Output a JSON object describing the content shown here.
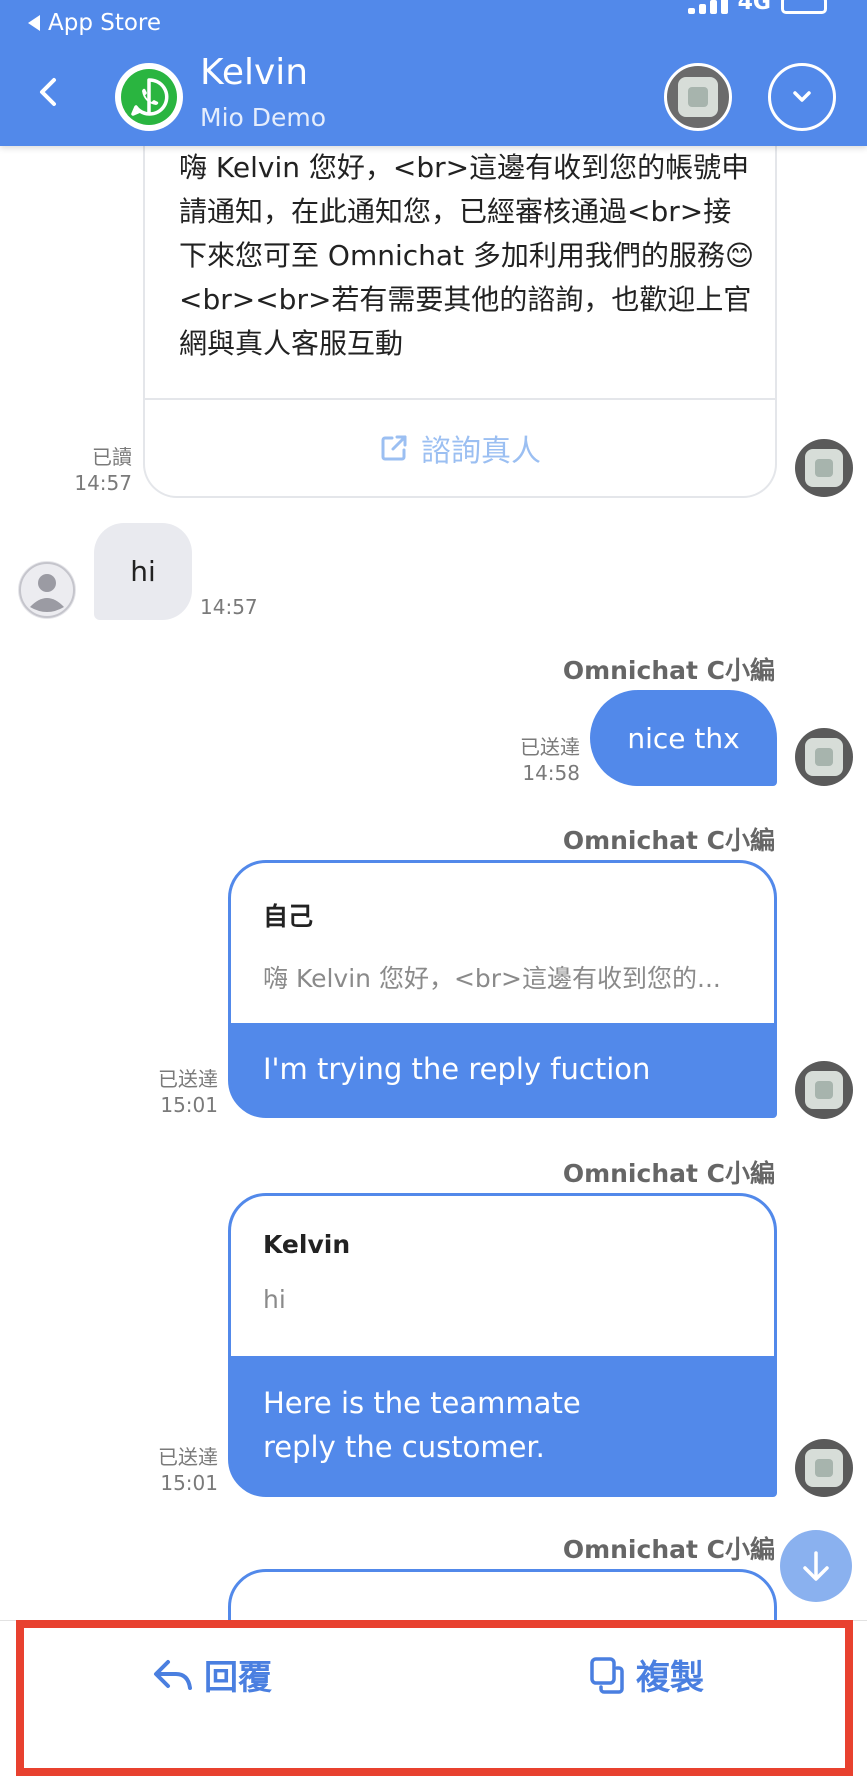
{
  "status_bar": {
    "back_app": "App Store",
    "network": "4G"
  },
  "header": {
    "title": "Kelvin",
    "subtitle": "Mio Demo"
  },
  "messages": {
    "bot_card": {
      "text": "嗨 Kelvin 您好，<br>這邊有收到您的帳號申請通知，在此通知您，已經審核通過<br>接下來您可至 Omnichat 多加利用我們的服務😊<br><br>若有需要其他的諮詢，也歡迎上官網與真人客服互動",
      "button": "諮詢真人",
      "status": "已讀",
      "time": "14:57"
    },
    "customer_msg": {
      "text": "hi",
      "time": "14:57"
    },
    "agent_msg_1": {
      "sender": "Omnichat C小編",
      "text": "nice thx",
      "status": "已送達",
      "time": "14:58"
    },
    "agent_reply_1": {
      "sender": "Omnichat C小編",
      "quoted_name": "自己",
      "quoted_text": "嗨 Kelvin 您好，<br>這邊有收到您的...",
      "text": "I'm trying the reply fuction",
      "status": "已送達",
      "time": "15:01"
    },
    "agent_reply_2": {
      "sender": "Omnichat C小編",
      "quoted_name": "Kelvin",
      "quoted_text": "hi",
      "text": "Here is the teammate reply the customer.",
      "status": "已送達",
      "time": "15:01"
    },
    "agent_reply_3": {
      "sender": "Omnichat C小編"
    }
  },
  "actions": {
    "reply_label": "回覆",
    "copy_label": "複製"
  },
  "colors": {
    "header_bg": "#5289ea",
    "outgoing_bubble": "#5289ea",
    "incoming_bubble": "#e9eaef",
    "highlight": "#e8412f",
    "whatsapp": "#2ab540"
  },
  "icons": {
    "back": "chevron-left-icon",
    "channel": "whatsapp-icon",
    "menu": "chevron-down-icon",
    "external": "external-link-icon",
    "scroll": "arrow-down-icon",
    "reply": "reply-icon",
    "copy": "copy-icon"
  }
}
